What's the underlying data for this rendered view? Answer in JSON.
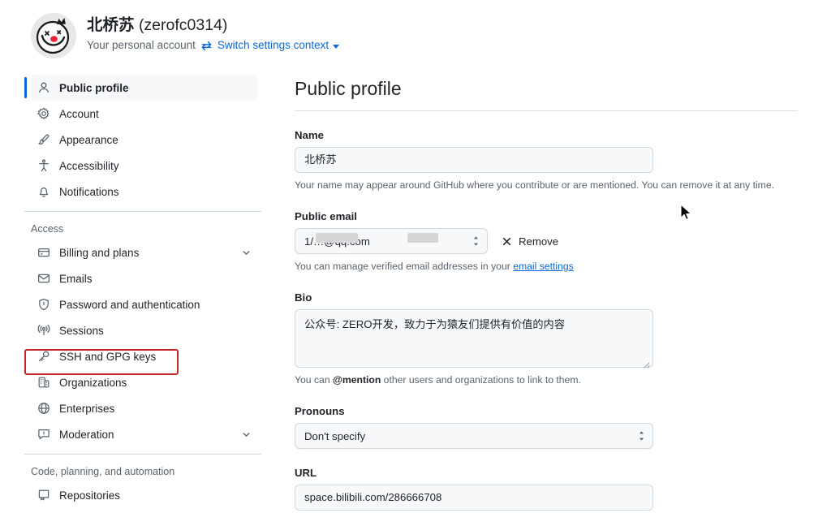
{
  "account": {
    "display_name": "北桥苏",
    "username": "(zerofc0314)",
    "subtitle": "Your personal account",
    "switch_link": "Switch settings context",
    "avatar_icon": "smiley-crown-avatar",
    "swap_icon": "swap-arrows-icon",
    "caret_icon": "chevron-down-icon"
  },
  "sidebar": {
    "primary": [
      {
        "label": "Public profile",
        "icon": "person-icon",
        "active": true,
        "chevron": false
      },
      {
        "label": "Account",
        "icon": "gear-icon",
        "active": false,
        "chevron": false
      },
      {
        "label": "Appearance",
        "icon": "paintbrush-icon",
        "active": false,
        "chevron": false
      },
      {
        "label": "Accessibility",
        "icon": "accessibility-icon",
        "active": false,
        "chevron": false
      },
      {
        "label": "Notifications",
        "icon": "bell-icon",
        "active": false,
        "chevron": false
      }
    ],
    "access_title": "Access",
    "access": [
      {
        "label": "Billing and plans",
        "icon": "credit-card-icon",
        "active": false,
        "chevron": true
      },
      {
        "label": "Emails",
        "icon": "mail-icon",
        "active": false,
        "chevron": false
      },
      {
        "label": "Password and authentication",
        "icon": "shield-lock-icon",
        "active": false,
        "chevron": false
      },
      {
        "label": "Sessions",
        "icon": "broadcast-icon",
        "active": false,
        "chevron": false
      },
      {
        "label": "SSH and GPG keys",
        "icon": "key-icon",
        "active": false,
        "chevron": false,
        "highlighted": true
      },
      {
        "label": "Organizations",
        "icon": "organization-icon",
        "active": false,
        "chevron": false
      },
      {
        "label": "Enterprises",
        "icon": "globe-icon",
        "active": false,
        "chevron": false
      },
      {
        "label": "Moderation",
        "icon": "report-icon",
        "active": false,
        "chevron": true
      }
    ],
    "code_title": "Code, planning, and automation",
    "code": [
      {
        "label": "Repositories",
        "icon": "repo-icon",
        "active": false,
        "chevron": false
      }
    ],
    "highlight_color": "#c3272b",
    "active_accent_color": "#0969da"
  },
  "main": {
    "page_title": "Public profile",
    "name": {
      "label": "Name",
      "value": "北桥苏",
      "help": "Your name may appear around GitHub where you contribute or are mentioned. You can remove it at any time."
    },
    "public_email": {
      "label": "Public email",
      "value": "1/…@qq.com",
      "remove_label": "Remove",
      "remove_icon": "x-icon",
      "help_prefix": "You can manage verified email addresses in your ",
      "help_link": "email settings"
    },
    "bio": {
      "label": "Bio",
      "value": "公众号: ZERO开发，致力于为猿友们提供有价值的内容",
      "help_prefix": "You can ",
      "help_mention": "@mention",
      "help_suffix": " other users and organizations to link to them."
    },
    "pronouns": {
      "label": "Pronouns",
      "value": "Don't specify"
    },
    "url": {
      "label": "URL",
      "value": "space.bilibili.com/286666708"
    }
  },
  "cursor": {
    "icon": "mouse-pointer-icon"
  }
}
